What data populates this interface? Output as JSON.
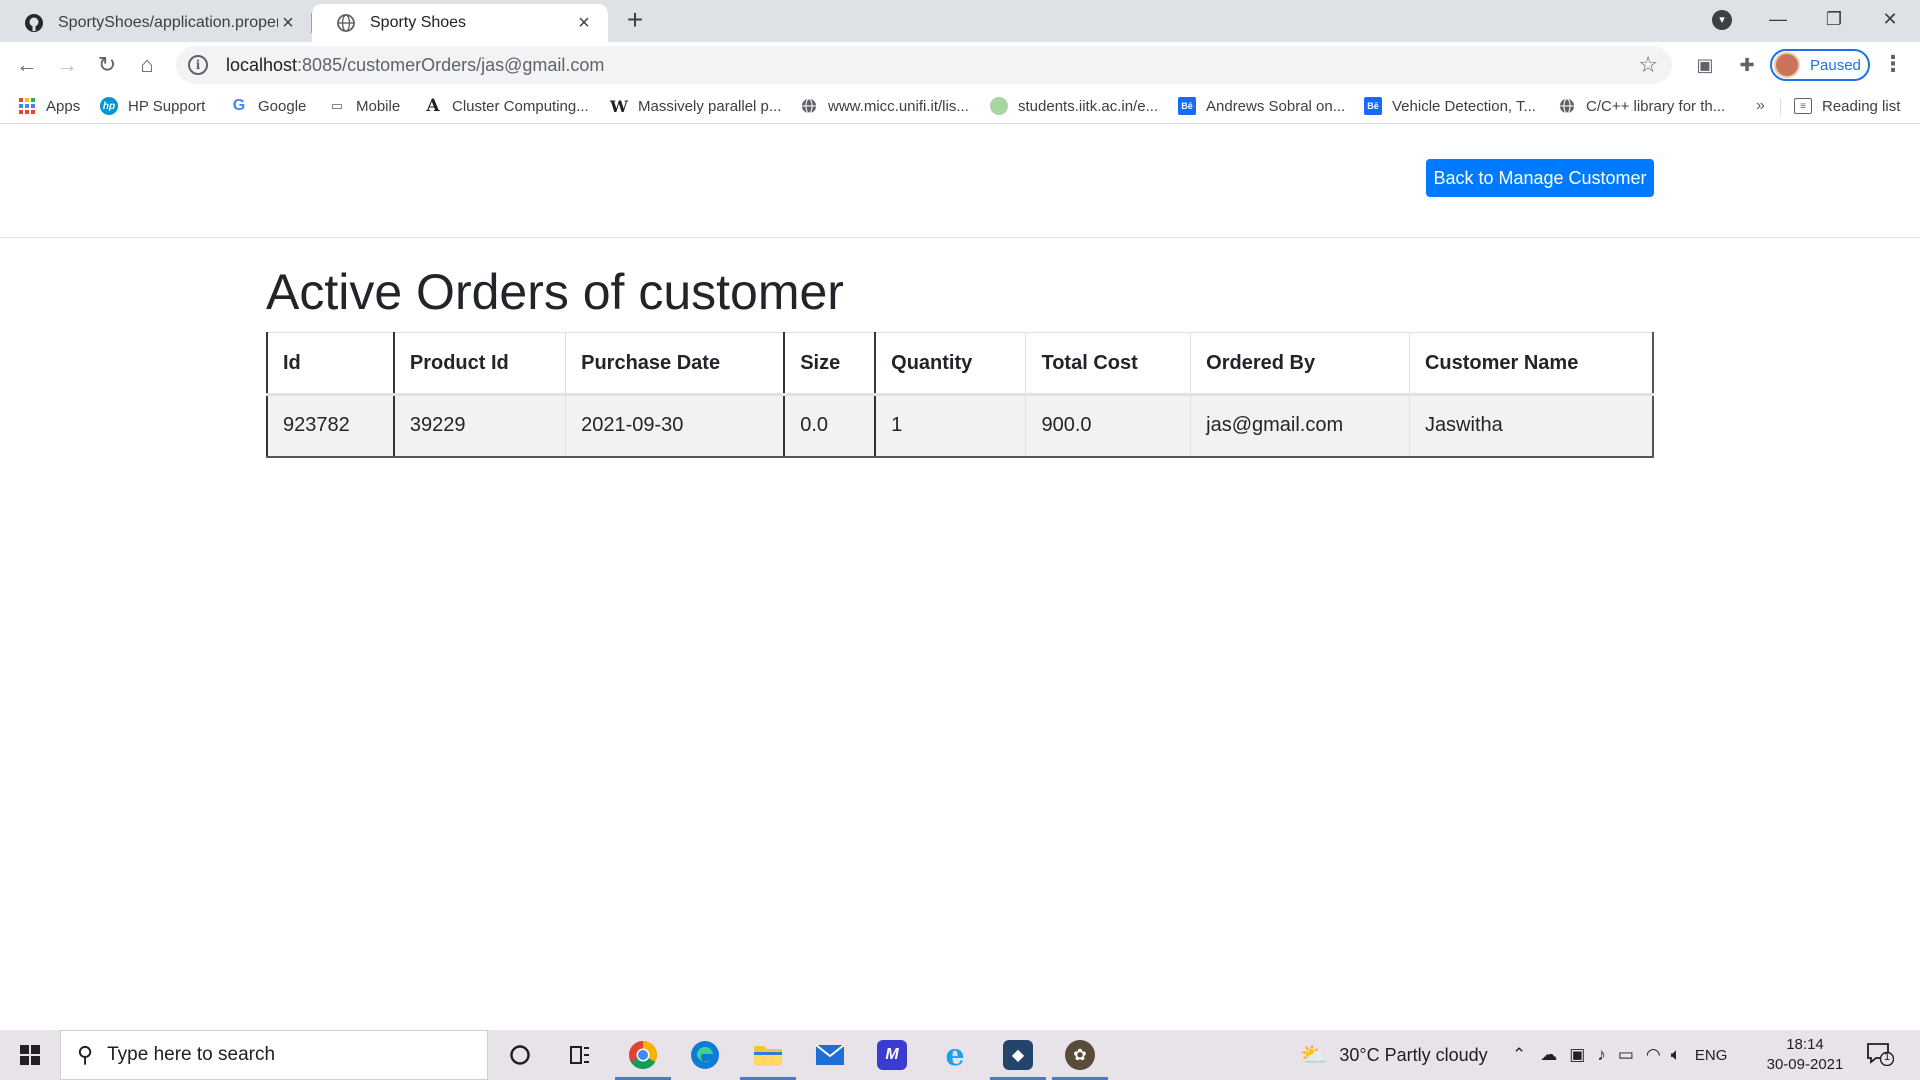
{
  "browser": {
    "tabs": [
      {
        "title": "SportyShoes/application.properti",
        "icon": "github-icon",
        "active": false
      },
      {
        "title": "Sporty Shoes",
        "icon": "globe-icon",
        "active": true
      }
    ],
    "address": {
      "host": "localhost",
      "path": ":8085/customerOrders/jas@gmail.com"
    },
    "profile_label": "Paused",
    "bookmarks": [
      {
        "label": "Apps",
        "icon": "apps-grid-icon"
      },
      {
        "label": "HP Support",
        "icon": "hp-icon"
      },
      {
        "label": "Google",
        "icon": "google-icon"
      },
      {
        "label": "Mobile",
        "icon": "mobile-icon"
      },
      {
        "label": "Cluster Computing...",
        "icon": "letter-a-icon"
      },
      {
        "label": "Massively parallel p...",
        "icon": "wikipedia-icon"
      },
      {
        "label": "www.micc.unifi.it/lis...",
        "icon": "globe-icon"
      },
      {
        "label": "students.iitk.ac.in/e...",
        "icon": "iitk-icon"
      },
      {
        "label": "Andrews Sobral on...",
        "icon": "behance-icon"
      },
      {
        "label": "Vehicle Detection, T...",
        "icon": "behance-icon"
      },
      {
        "label": "C/C++ library for th...",
        "icon": "globe-icon"
      }
    ],
    "bookmarks_more": "»",
    "reading_list": "Reading list"
  },
  "page": {
    "back_button": "Back to Manage Customer",
    "title": "Active Orders of customer",
    "table": {
      "headers": [
        "Id",
        "Product Id",
        "Purchase Date",
        "Size",
        "Quantity",
        "Total Cost",
        "Ordered By",
        "Customer Name"
      ],
      "rows": [
        [
          "923782",
          "39229",
          "2021-09-30",
          "0.0",
          "1",
          "900.0",
          "jas@gmail.com",
          "Jaswitha"
        ]
      ]
    }
  },
  "taskbar": {
    "search_placeholder": "Type here to search",
    "weather": "30°C  Partly cloudy",
    "language": "ENG",
    "time": "18:14",
    "date": "30-09-2021",
    "notification_count": "1"
  }
}
